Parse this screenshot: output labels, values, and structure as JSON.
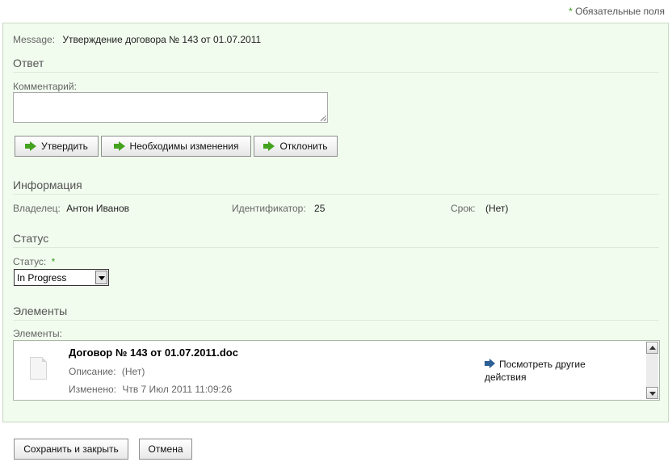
{
  "required_note": {
    "star": "*",
    "text": "Обязательные поля"
  },
  "message": {
    "label": "Message:",
    "value": "Утверждение договора № 143 от 01.07.2011"
  },
  "answer": {
    "title": "Ответ",
    "comment_label": "Комментарий:",
    "comment_value": "",
    "buttons": {
      "approve": "Утвердить",
      "changes": "Необходимы изменения",
      "reject": "Отклонить"
    }
  },
  "info": {
    "title": "Информация",
    "owner_label": "Владелец:",
    "owner_value": "Антон Иванов",
    "id_label": "Идентификатор:",
    "id_value": "25",
    "due_label": "Срок:",
    "due_value": "(Нет)"
  },
  "status": {
    "title": "Статус",
    "label": "Статус:",
    "required_star": "*",
    "selected": "In Progress"
  },
  "elements": {
    "title": "Элементы",
    "label": "Элементы:",
    "item": {
      "name": "Договор № 143 от 01.07.2011.doc",
      "desc_label": "Описание:",
      "desc_value": "(Нет)",
      "modified_label": "Изменено:",
      "modified_value": "Чтв 7 Июл 2011 11:09:26",
      "action_line1": "Посмотреть другие",
      "action_line2": "действия"
    }
  },
  "footer": {
    "save_close": "Сохранить и закрыть",
    "cancel": "Отмена"
  },
  "colors": {
    "panel_bg": "#f1fbee",
    "accent_green": "#45a21f",
    "link_blue": "#2b5f96"
  }
}
